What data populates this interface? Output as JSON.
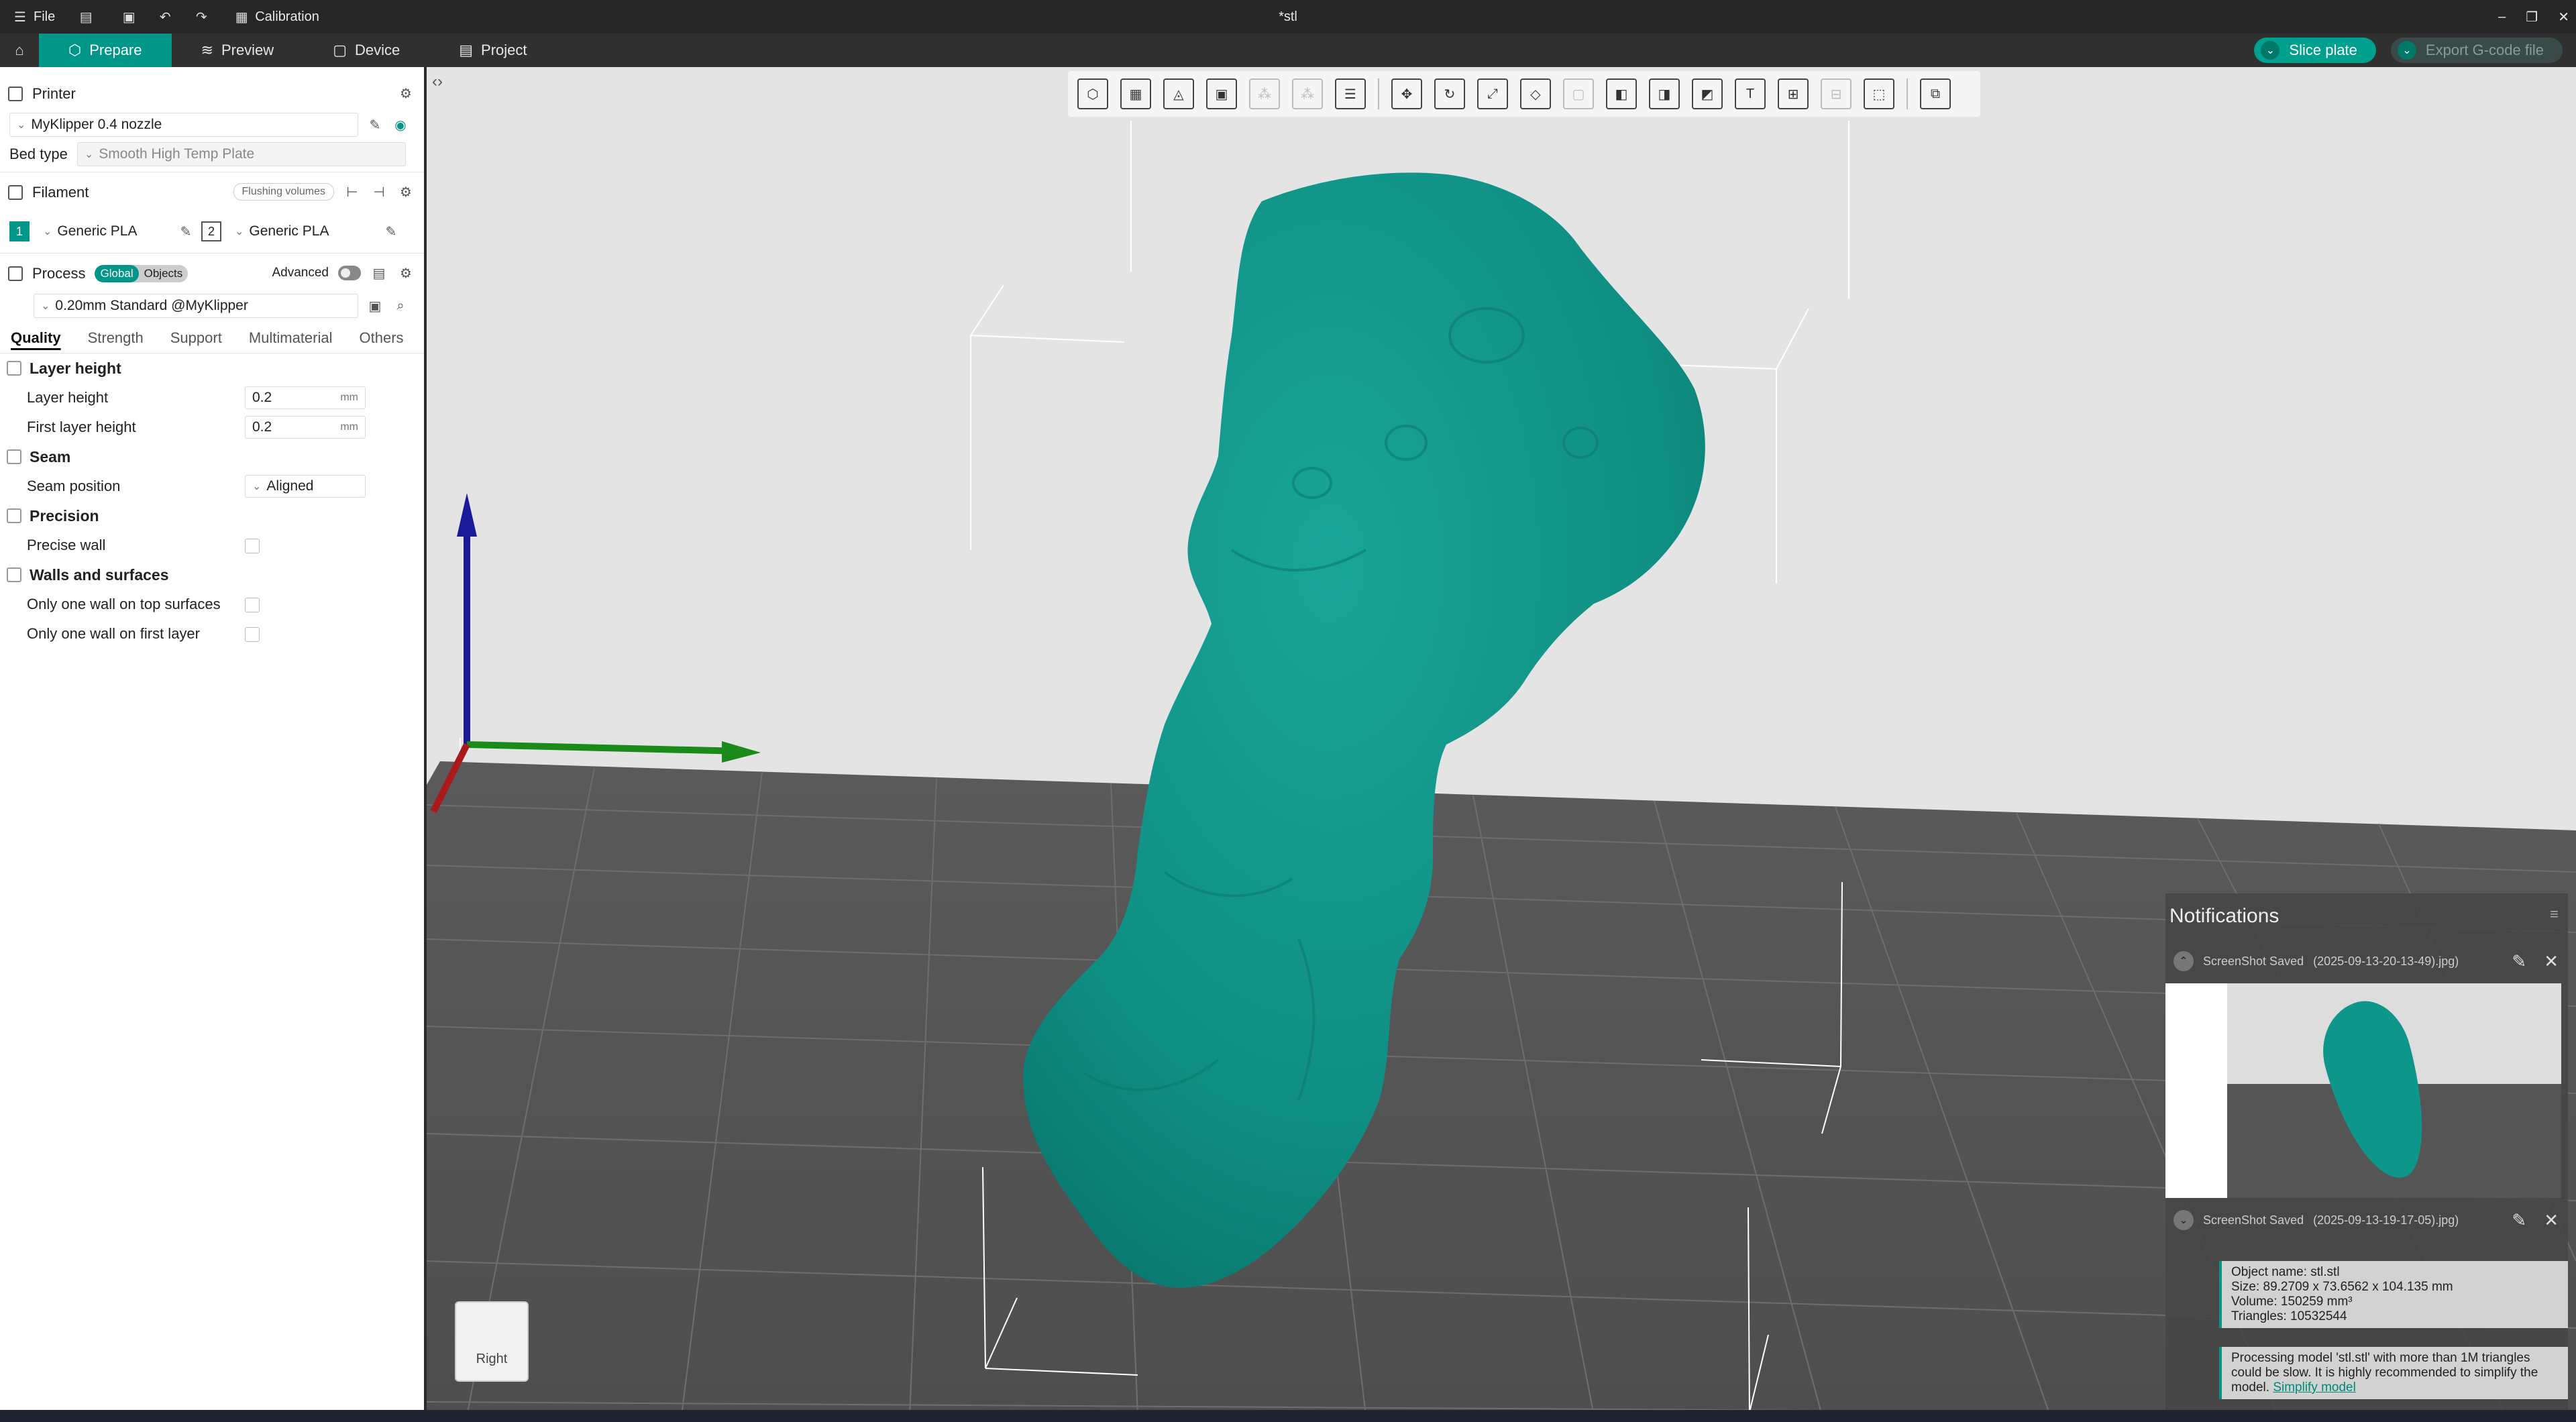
{
  "titlebar": {
    "file_label": "File",
    "calibration_label": "Calibration",
    "doc_title": "*stl",
    "controls": [
      "–",
      "❐",
      "✕"
    ]
  },
  "tabs": {
    "prepare": "Prepare",
    "preview": "Preview",
    "device": "Device",
    "project": "Project"
  },
  "actions": {
    "slice": "Slice plate",
    "export": "Export G-code file"
  },
  "printer": {
    "section": "Printer",
    "name": "MyKlipper 0.4 nozzle",
    "bed_label": "Bed type",
    "bed_value": "Smooth High Temp Plate"
  },
  "filament": {
    "section": "Filament",
    "flushing": "Flushing volumes",
    "slots": [
      {
        "num": "1",
        "name": "Generic PLA"
      },
      {
        "num": "2",
        "name": "Generic PLA"
      }
    ]
  },
  "process": {
    "section": "Process",
    "global": "Global",
    "objects": "Objects",
    "advanced": "Advanced",
    "profile": "0.20mm Standard @MyKlipper",
    "tabs": [
      "Quality",
      "Strength",
      "Support",
      "Multimaterial",
      "Others"
    ]
  },
  "quality": {
    "layer_group": "Layer height",
    "layer_height_label": "Layer height",
    "layer_height_value": "0.2",
    "first_layer_label": "First layer height",
    "first_layer_value": "0.2",
    "unit": "mm",
    "seam_group": "Seam",
    "seam_position_label": "Seam position",
    "seam_position_value": "Aligned",
    "precision_group": "Precision",
    "precise_wall_label": "Precise wall",
    "walls_group": "Walls and surfaces",
    "one_wall_top_label": "Only one wall on top surfaces",
    "one_wall_first_label": "Only one wall on first layer"
  },
  "viewport": {
    "cube_label": "Right",
    "model_color": "#0f968a"
  },
  "notifications": {
    "title": "Notifications",
    "items": [
      {
        "text": "ScreenShot Saved",
        "stamp": "(2025-09-13-20-13-49).jpg)"
      },
      {
        "text": "ScreenShot Saved",
        "stamp": "(2025-09-13-19-17-05).jpg)"
      }
    ],
    "object_info": {
      "name": "Object name: stl.stl",
      "size": "Size: 89.2709 x 73.6562 x 104.135 mm",
      "volume": "Volume: 150259 mm³",
      "triangles": "Triangles: 10532544"
    },
    "processing": "Processing model 'stl.stl' with more than 1M triangles could be slow. It is highly recommended to simplify the model.",
    "simplify_link": "Simplify model"
  }
}
